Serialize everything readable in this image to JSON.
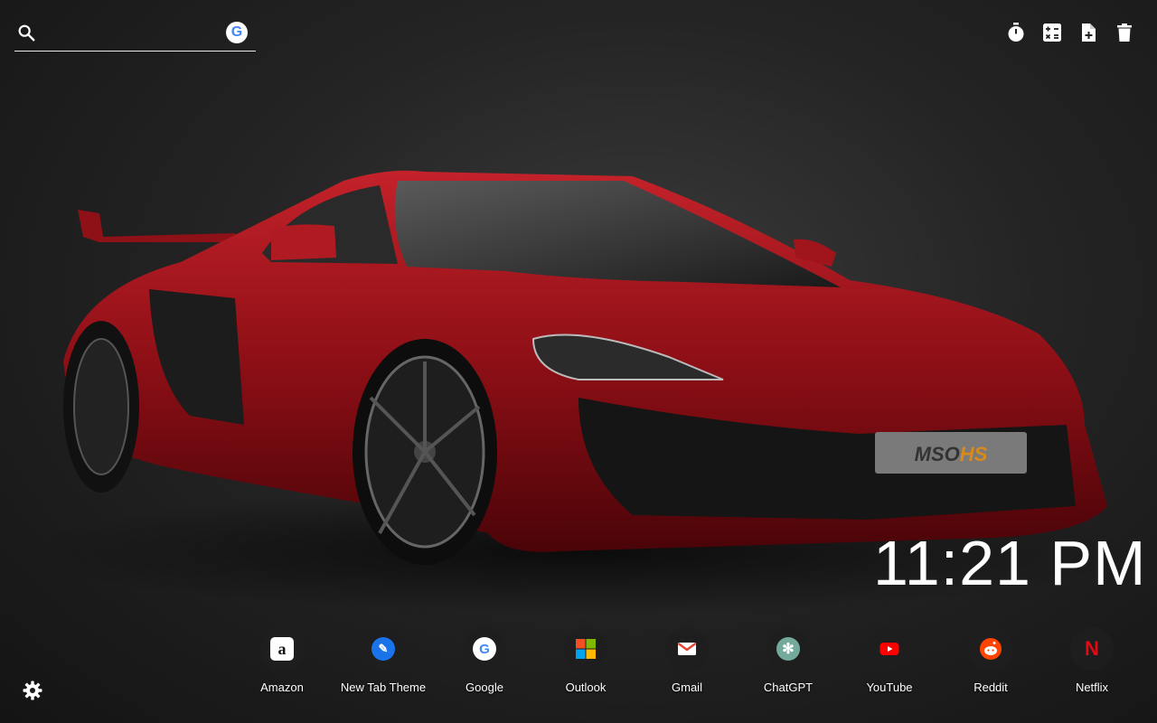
{
  "search": {
    "placeholder": "",
    "engine_icon": "google-icon"
  },
  "toolbar": {
    "icons": [
      "timer-icon",
      "calculator-icon",
      "add-note-icon",
      "trash-icon"
    ]
  },
  "background": {
    "subject": "red sports car",
    "plate": "MSO HS"
  },
  "clock": {
    "time": "11:21 PM"
  },
  "shortcuts": [
    {
      "label": "Amazon",
      "icon": "amazon-icon",
      "color": "#ffffff"
    },
    {
      "label": "New Tab Theme",
      "icon": "newtab-theme-icon",
      "color": "#1a73e8"
    },
    {
      "label": "Google",
      "icon": "google-icon",
      "color": "#ffffff"
    },
    {
      "label": "Outlook",
      "icon": "outlook-icon",
      "color": "#0078d4"
    },
    {
      "label": "Gmail",
      "icon": "gmail-icon",
      "color": "#ffffff"
    },
    {
      "label": "ChatGPT",
      "icon": "chatgpt-icon",
      "color": "#74aa9c"
    },
    {
      "label": "YouTube",
      "icon": "youtube-icon",
      "color": "#ff0000"
    },
    {
      "label": "Reddit",
      "icon": "reddit-icon",
      "color": "#ff4500"
    },
    {
      "label": "Netflix",
      "icon": "netflix-icon",
      "color": "#e50914"
    }
  ],
  "settings": {
    "icon": "gear-icon"
  }
}
